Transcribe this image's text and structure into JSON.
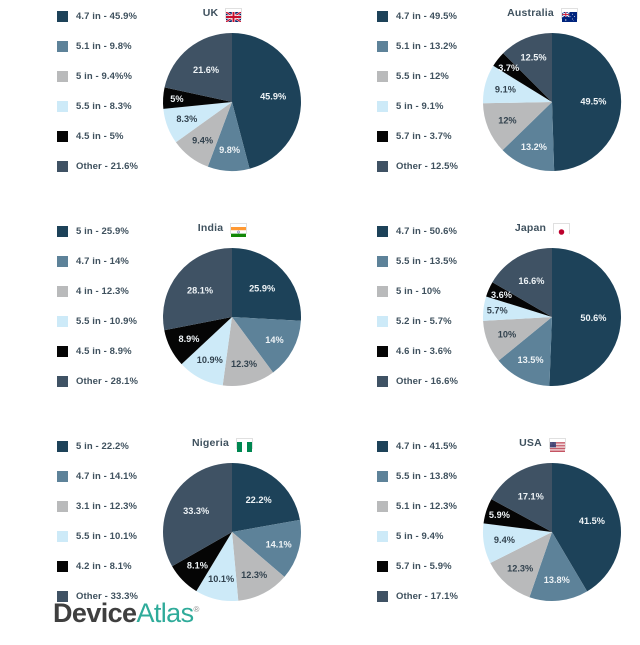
{
  "palette": {
    "series": [
      "#1d4259",
      "#5d8299",
      "#b9babb",
      "#cdeaf8",
      "#050505",
      "#3f5264"
    ],
    "legend_text": "#3f515e",
    "background": "#ffffff",
    "logo_dark": "#3f3f3f",
    "logo_teal": "#2fab9a"
  },
  "footer": {
    "logo_part1": "Device",
    "logo_part2": "Atlas",
    "trademark": "®"
  },
  "chart_data": [
    {
      "type": "pie",
      "title": "UK",
      "flag": "flag-uk",
      "legend_position": "left",
      "categories": [
        "4.7 in",
        "5.1 in",
        "5 in",
        "5.5 in",
        "4.5 in",
        "Other"
      ],
      "values": [
        45.9,
        9.8,
        9.4,
        8.3,
        5,
        21.6
      ],
      "legend_labels": [
        "4.7 in - 45.9%",
        "5.1 in - 9.8%",
        "5 in - 9.4%%",
        "5.5 in - 8.3%",
        "4.5 in - 5%",
        "Other - 21.6%"
      ],
      "slice_labels": [
        "45.9%",
        "9.8%",
        "9.4%",
        "8.3%",
        "5%",
        "21.6%"
      ]
    },
    {
      "type": "pie",
      "title": "Australia",
      "flag": "flag-australia",
      "legend_position": "left",
      "categories": [
        "4.7 in",
        "5.1 in",
        "5.5 in",
        "5 in",
        "5.7 in",
        "Other"
      ],
      "values": [
        49.5,
        13.2,
        12,
        9.1,
        3.7,
        12.5
      ],
      "legend_labels": [
        "4.7 in - 49.5%",
        "5.1 in - 13.2%",
        "5.5 in - 12%",
        "5 in - 9.1%",
        "5.7 in - 3.7%",
        "Other - 12.5%"
      ],
      "slice_labels": [
        "49.5%",
        "13.2%",
        "12%",
        "9.1%",
        "3.7%",
        "12.5%"
      ]
    },
    {
      "type": "pie",
      "title": "India",
      "flag": "flag-india",
      "legend_position": "left",
      "categories": [
        "5 in",
        "4.7 in",
        "4 in",
        "5.5 in",
        "4.5 in",
        "Other"
      ],
      "values": [
        25.9,
        14,
        12.3,
        10.9,
        8.9,
        28.1
      ],
      "legend_labels": [
        "5 in - 25.9%",
        "4.7 in - 14%",
        "4 in - 12.3%",
        "5.5 in - 10.9%",
        "4.5 in - 8.9%",
        "Other - 28.1%"
      ],
      "slice_labels": [
        "25.9%",
        "14%",
        "12.3%",
        "10.9%",
        "8.9%",
        "28.1%"
      ]
    },
    {
      "type": "pie",
      "title": "Japan",
      "flag": "flag-japan",
      "legend_position": "left",
      "categories": [
        "4.7 in",
        "5.5 in",
        "5 in",
        "5.2 in",
        "4.6 in",
        "Other"
      ],
      "values": [
        50.6,
        13.5,
        10,
        5.7,
        3.6,
        16.6
      ],
      "legend_labels": [
        "4.7 in - 50.6%",
        "5.5 in - 13.5%",
        "5 in - 10%",
        "5.2 in - 5.7%",
        "4.6 in - 3.6%",
        "Other - 16.6%"
      ],
      "slice_labels": [
        "50.6%",
        "13.5%",
        "10%",
        "5.7%",
        "3.6%",
        "16.6%"
      ]
    },
    {
      "type": "pie",
      "title": "Nigeria",
      "flag": "flag-nigeria",
      "legend_position": "left",
      "categories": [
        "5 in",
        "4.7 in",
        "3.1 in",
        "5.5 in",
        "4.2 in",
        "Other"
      ],
      "values": [
        22.2,
        14.1,
        12.3,
        10.1,
        8.1,
        33.3
      ],
      "legend_labels": [
        "5 in - 22.2%",
        "4.7 in - 14.1%",
        "3.1 in - 12.3%",
        "5.5 in - 10.1%",
        "4.2 in - 8.1%",
        "Other - 33.3%"
      ],
      "slice_labels": [
        "22.2%",
        "14.1%",
        "12.3%",
        "10.1%",
        "8.1%",
        "33.3%"
      ]
    },
    {
      "type": "pie",
      "title": "USA",
      "flag": "flag-usa",
      "legend_position": "left",
      "categories": [
        "4.7 in",
        "5.5 in",
        "5.1 in",
        "5 in",
        "5.7 in",
        "Other"
      ],
      "values": [
        41.5,
        13.8,
        12.3,
        9.4,
        5.9,
        17.1
      ],
      "legend_labels": [
        "4.7 in - 41.5%",
        "5.5 in - 13.8%",
        "5.1 in - 12.3%",
        "5 in - 9.4%",
        "5.7 in - 5.9%",
        "Other - 17.1%"
      ],
      "slice_labels": [
        "41.5%",
        "13.8%",
        "12.3%",
        "9.4%",
        "5.9%",
        "17.1%"
      ]
    }
  ]
}
